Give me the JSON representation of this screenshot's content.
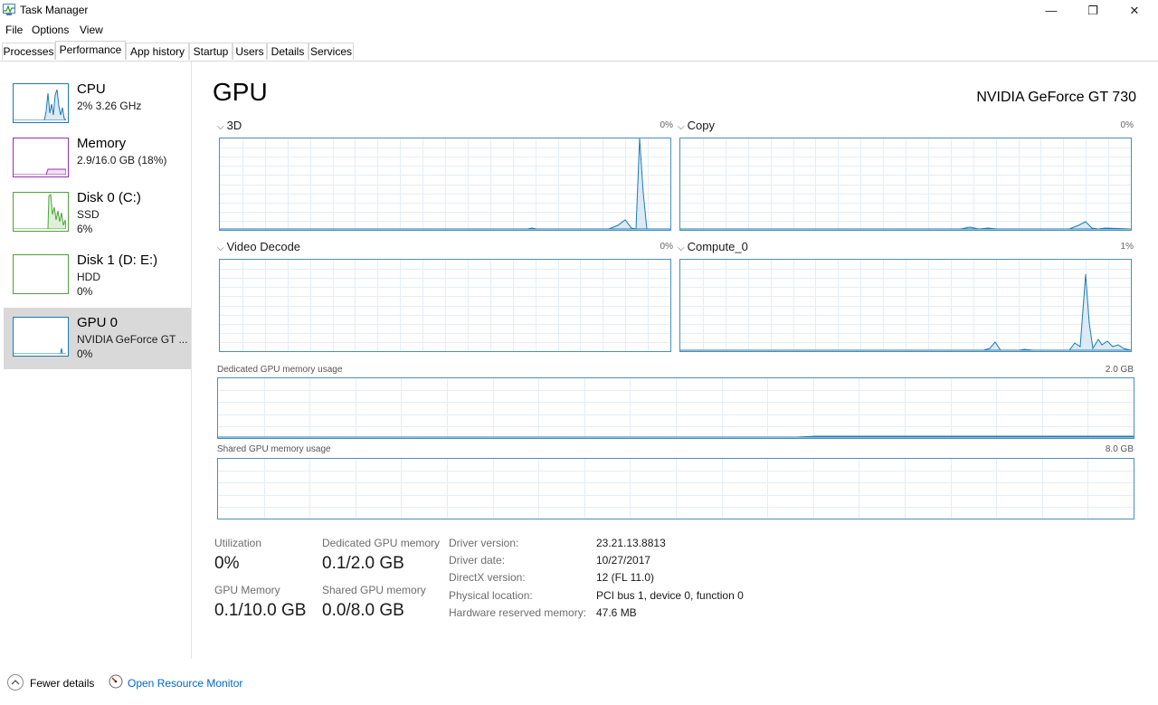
{
  "window": {
    "title": "Task Manager",
    "minimize": "—",
    "restore": "❐",
    "close": "✕"
  },
  "menu": [
    "File",
    "Options",
    "View"
  ],
  "tabs": [
    "Processes",
    "Performance",
    "App history",
    "Startup",
    "Users",
    "Details",
    "Services"
  ],
  "active_tab": "Performance",
  "sidebar": [
    {
      "name": "CPU",
      "line1": "2% 3.26 GHz",
      "line2": "",
      "color": "#1c7ab5"
    },
    {
      "name": "Memory",
      "line1": "2.9/16.0 GB (18%)",
      "line2": "",
      "color": "#9b2fae"
    },
    {
      "name": "Disk 0 (C:)",
      "line1": "SSD",
      "line2": "6%",
      "color": "#4ea33a"
    },
    {
      "name": "Disk 1 (D: E:)",
      "line1": "HDD",
      "line2": "0%",
      "color": "#4ea33a"
    },
    {
      "name": "GPU 0",
      "line1": "NVIDIA GeForce GT ...",
      "line2": "0%",
      "color": "#1c7ab5"
    }
  ],
  "main": {
    "title": "GPU",
    "model": "NVIDIA GeForce GT 730",
    "engines": [
      {
        "label": "3D",
        "pct": "0%"
      },
      {
        "label": "Copy",
        "pct": "0%"
      },
      {
        "label": "Video Decode",
        "pct": "0%"
      },
      {
        "label": "Compute_0",
        "pct": "1%"
      }
    ],
    "dedicated_label": "Dedicated GPU memory usage",
    "dedicated_max": "2.0 GB",
    "shared_label": "Shared GPU memory usage",
    "shared_max": "8.0 GB"
  },
  "stats": {
    "utilization_label": "Utilization",
    "utilization_value": "0%",
    "dedicated_label": "Dedicated GPU memory",
    "dedicated_value": "0.1/2.0 GB",
    "gpu_memory_label": "GPU Memory",
    "gpu_memory_value": "0.1/10.0 GB",
    "shared_label": "Shared GPU memory",
    "shared_value": "0.0/8.0 GB"
  },
  "info": [
    {
      "label": "Driver version:",
      "value": "23.21.13.8813"
    },
    {
      "label": "Driver date:",
      "value": "10/27/2017"
    },
    {
      "label": "DirectX version:",
      "value": "12 (FL 11.0)"
    },
    {
      "label": "Physical location:",
      "value": "PCI bus 1, device 0, function 0"
    },
    {
      "label": "Hardware reserved memory:",
      "value": "47.6 MB"
    }
  ],
  "footer": {
    "fewer_details": "Fewer details",
    "resource_monitor": "Open Resource Monitor"
  },
  "colors": {
    "graph_line": "#1c7ab5",
    "graph_border": "#4a90b8",
    "selected_bg": "#d9d9d9",
    "link": "#0066cc"
  }
}
